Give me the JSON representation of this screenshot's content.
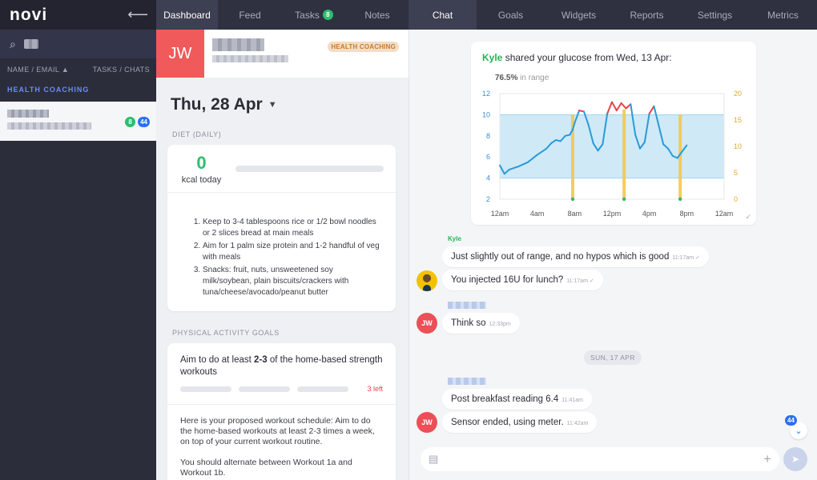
{
  "app": {
    "logo": "novi",
    "collapse_icon": "arrow-left-icon"
  },
  "sidebar": {
    "search_icon": "search-icon",
    "col_name": "NAME / EMAIL ▲",
    "col_tasks": "TASKS / CHATS",
    "group": "HEALTH COACHING",
    "contact": {
      "tasks": "8",
      "chats": "44"
    }
  },
  "tabs_left": [
    {
      "label": "Dashboard"
    },
    {
      "label": "Feed"
    },
    {
      "label": "Tasks",
      "badge": "8"
    },
    {
      "label": "Notes"
    }
  ],
  "tabs_right": [
    {
      "label": "Chat"
    },
    {
      "label": "Goals"
    },
    {
      "label": "Widgets"
    },
    {
      "label": "Reports"
    },
    {
      "label": "Settings"
    },
    {
      "label": "Metrics"
    }
  ],
  "patient": {
    "initials": "JW",
    "tag": "HEALTH COACHING"
  },
  "date": "Thu, 28 Apr",
  "diet": {
    "label": "DIET (DAILY)",
    "kcal": "0",
    "kcal_label": "kcal today",
    "items": [
      "Keep to 3-4 tablespoons rice or 1/2 bowl noodles or 2 slices bread at main meals",
      "Aim for 1 palm size protein and 1-2 handful of veg with meals",
      "Snacks: fruit, nuts, unsweetened soy milk/soybean, plain biscuits/crackers with tuna/cheese/avocado/peanut butter"
    ]
  },
  "activity": {
    "label": "PHYSICAL ACTIVITY GOALS",
    "title_pre": "Aim to do at least ",
    "title_bold": "2-3",
    "title_post": " of the home-based strength workouts",
    "left": "3 left",
    "body1": "Here is your proposed workout schedule: Aim to do the home-based workouts at least 2-3 times a week, on top of your current workout routine.",
    "body2": "You should alternate between Workout 1a and Workout 1b."
  },
  "chart_header": {
    "sender": "Kyle",
    "text": " shared your glucose from Wed, 13 Apr:",
    "range_pct": "76.5%",
    "range_label": " in range"
  },
  "chart_data": {
    "type": "line",
    "x_ticks": [
      "12am",
      "4am",
      "8am",
      "12pm",
      "4pm",
      "8pm",
      "12am"
    ],
    "y_left_ticks": [
      "2",
      "4",
      "6",
      "8",
      "10",
      "12"
    ],
    "y_right_ticks": [
      "0",
      "5",
      "10",
      "15",
      "20"
    ],
    "ylim": [
      2,
      12
    ],
    "target_range": [
      4,
      10
    ],
    "glucose": {
      "x_hours": [
        0,
        0.5,
        1,
        2,
        3,
        4,
        5,
        5.5,
        6,
        6.5,
        7,
        7.5,
        7.8,
        8,
        8.5,
        9,
        9.5,
        10,
        10.5,
        11,
        11.5,
        12,
        12.5,
        13,
        13.5,
        14,
        14.5,
        15,
        15.5,
        16,
        16.5,
        17,
        17.5,
        18,
        18.5,
        19,
        19.5,
        20
      ],
      "values": [
        5.2,
        4.4,
        4.8,
        5.1,
        5.5,
        6.2,
        6.8,
        7.3,
        7.6,
        7.5,
        8.0,
        8.1,
        8.6,
        9.2,
        10.4,
        10.3,
        9.0,
        7.3,
        6.6,
        7.2,
        10.1,
        11.2,
        10.4,
        11.1,
        10.6,
        11.0,
        8.1,
        6.8,
        7.4,
        10.1,
        10.8,
        9.0,
        7.2,
        6.8,
        6.1,
        5.9,
        6.5,
        7.1
      ]
    },
    "insulin": {
      "x_hours": [
        7.8,
        13.3,
        19.3
      ],
      "values": [
        16,
        17,
        16
      ]
    }
  },
  "messages": [
    {
      "sender": "Kyle",
      "text": "Just slightly out of range, and no hypos which is good",
      "time": "11:17am",
      "check": "✓"
    },
    {
      "text": "You injected 16U for lunch?",
      "time": "11:17am",
      "check": "✓"
    },
    {
      "text": "Think so",
      "time": "12:33pm"
    },
    {
      "text": "Post breakfast reading 6.4",
      "time": "11:41am"
    },
    {
      "text": "Sensor ended, using meter.",
      "time": "11:42am"
    }
  ],
  "day_separator": "SUN, 17 APR",
  "unread": "44"
}
